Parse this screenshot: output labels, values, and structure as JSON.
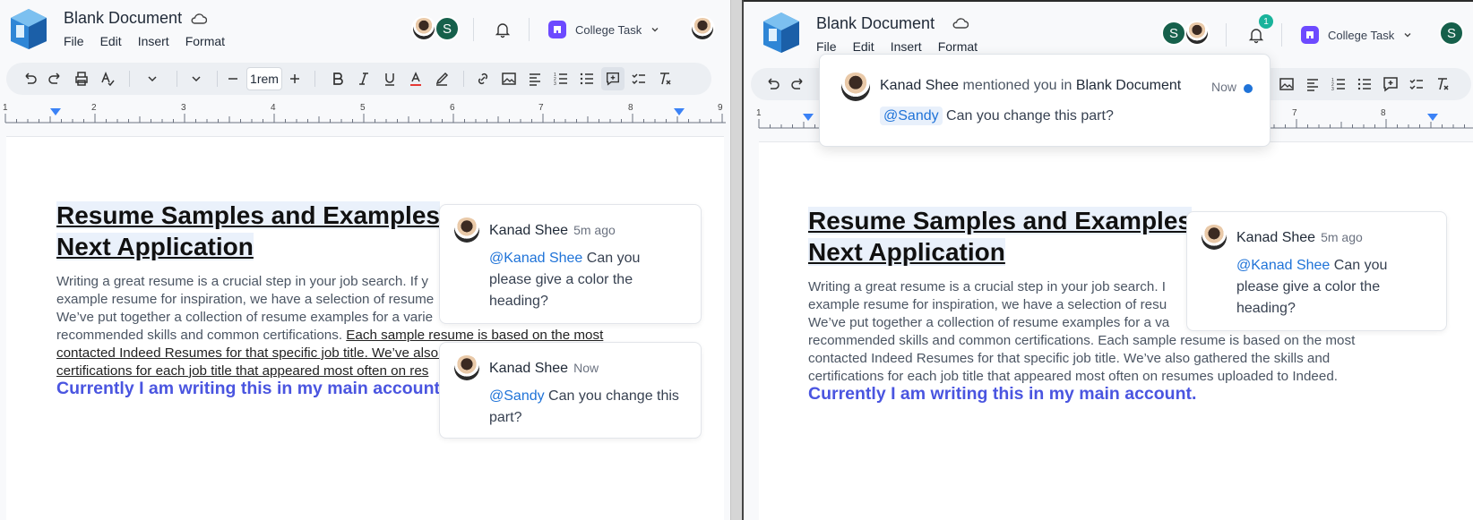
{
  "document": {
    "title": "Blank Document",
    "menu": [
      "File",
      "Edit",
      "Insert",
      "Format"
    ]
  },
  "workspace": {
    "name": "College Task"
  },
  "avatar_initial": "S",
  "notification_count": "1",
  "toolbar": {
    "font_size": "1rem"
  },
  "ruler": {
    "numbers": [
      "1",
      "2",
      "3",
      "4",
      "5",
      "6",
      "7",
      "8",
      "9"
    ]
  },
  "content": {
    "heading_line1": "Resume Samples and Examples",
    "heading_line2": "Next Application",
    "paragraph_left_l1": "Writing a great resume is a crucial step in your job search. If y",
    "paragraph_left_l2": "example resume for inspiration, we have a selection of resume",
    "paragraph_left_l3": "We’ve put together a collection of resume examples for a varie",
    "paragraph_left_l4a": "recommended skills and common certifications. ",
    "paragraph_left_l4b": "Each sample resume is based on the most",
    "paragraph_left_l5": "contacted Indeed Resumes for that specific job title. We’ve also gathered the skills and",
    "paragraph_left_l6": "certifications for each job title that appeared most often on res",
    "blue_left": "Currently I am writing this in my main account",
    "paragraph_right_l1": "Writing a great resume is a crucial step in your job search. I",
    "paragraph_right_l2": "example resume for inspiration, we have a selection of resu",
    "paragraph_right_l3": "We’ve put together a collection of resume examples for a va",
    "paragraph_right_l4": "recommended skills and common certifications. Each sample resume is based on the most",
    "paragraph_right_l5": "contacted Indeed Resumes for that specific job title. We’ve also gathered the skills and",
    "paragraph_right_l6": "certifications for each job title that appeared most often on resumes uploaded to Indeed.",
    "blue_right": "Currently I am writing this in my main account."
  },
  "comments": [
    {
      "author": "Kanad Shee",
      "time": "5m ago",
      "mention": "@Kanad Shee",
      "text_l1": " Can you",
      "text_l2": "please give a color the",
      "text_l3": "heading?"
    },
    {
      "author": "Kanad Shee",
      "time": "Now",
      "mention": "@Sandy",
      "text_l1": " Can you change this",
      "text_l2": "part?"
    }
  ],
  "notification": {
    "author": "Kanad Shee",
    "action": " mentioned you in ",
    "doc": "Blank Document",
    "time": "Now",
    "mention": "@Sandy",
    "text": " Can you change this part?"
  },
  "colors": {
    "accent_blue": "#1f73d8",
    "heading_blue": "#4a55e0",
    "avatar_green": "#16604b",
    "badge_teal": "#19b39b",
    "workspace_purple": "#6d4aff"
  }
}
